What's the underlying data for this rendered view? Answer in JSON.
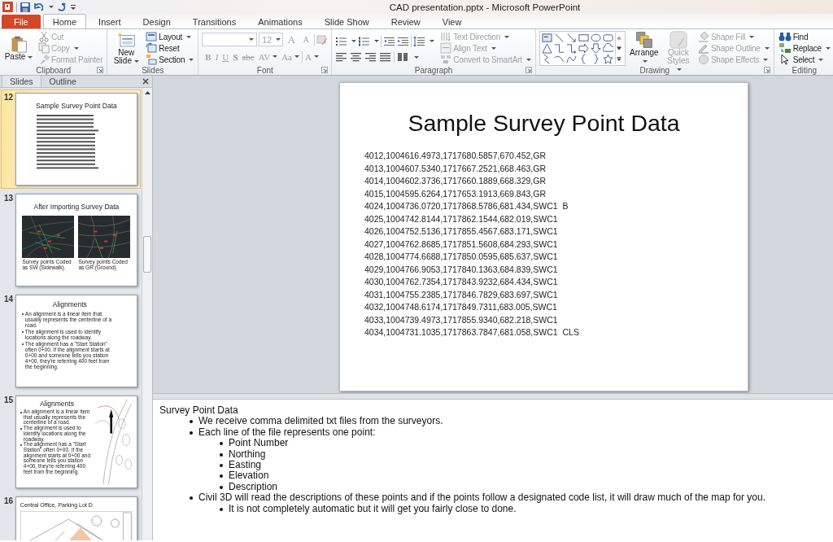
{
  "window": {
    "title": "CAD presentation.pptx  -  Microsoft PowerPoint"
  },
  "ribbon_tabs": [
    {
      "label": "File",
      "kind": "file",
      "selected": false
    },
    {
      "label": "Home",
      "kind": "tab",
      "selected": true
    },
    {
      "label": "Insert",
      "kind": "tab",
      "selected": false
    },
    {
      "label": "Design",
      "kind": "tab",
      "selected": false
    },
    {
      "label": "Transitions",
      "kind": "tab",
      "selected": false
    },
    {
      "label": "Animations",
      "kind": "tab",
      "selected": false
    },
    {
      "label": "Slide Show",
      "kind": "tab",
      "selected": false
    },
    {
      "label": "Review",
      "kind": "tab",
      "selected": false
    },
    {
      "label": "View",
      "kind": "tab",
      "selected": false
    }
  ],
  "ribbon_groups": [
    {
      "label": "Clipboard",
      "kind": "clipboard",
      "launcher": true,
      "large": [
        {
          "label": "Paste",
          "caret": true,
          "disabled": false
        }
      ],
      "small": [
        {
          "label": "Cut",
          "caret": false,
          "disabled": true
        },
        {
          "label": "Copy",
          "caret": true,
          "disabled": true
        },
        {
          "label": "Format Painter",
          "caret": false,
          "disabled": true
        }
      ]
    },
    {
      "label": "Slides",
      "kind": "slides",
      "launcher": false,
      "large": [
        {
          "label": "New Slide",
          "caret": true,
          "disabled": false
        }
      ],
      "small": [
        {
          "label": "Layout",
          "caret": true,
          "disabled": false
        },
        {
          "label": "Reset",
          "caret": false,
          "disabled": false
        },
        {
          "label": "Section",
          "caret": true,
          "disabled": false
        }
      ]
    },
    {
      "label": "Font",
      "kind": "font",
      "launcher": true,
      "disabled": true,
      "size": "12",
      "size_buttons": [
        "A",
        "A"
      ],
      "buttons": [
        "B",
        "I",
        "U",
        "S",
        "abc",
        "AV",
        "Aa",
        "A"
      ]
    },
    {
      "label": "Paragraph",
      "kind": "paragraph",
      "launcher": true,
      "small": [
        {
          "label": "Text Direction",
          "caret": true,
          "disabled": true
        },
        {
          "label": "Align Text",
          "caret": true,
          "disabled": true
        },
        {
          "label": "Convert to SmartArt",
          "caret": true,
          "disabled": true
        }
      ]
    },
    {
      "label": "Drawing",
      "kind": "drawing",
      "launcher": true,
      "large": [
        {
          "label": "Arrange",
          "caret": true,
          "disabled": false
        },
        {
          "label": "Quick Styles",
          "caret": true,
          "disabled": true
        }
      ],
      "small": [
        {
          "label": "Shape Fill",
          "caret": true,
          "disabled": true
        },
        {
          "label": "Shape Outline",
          "caret": true,
          "disabled": true
        },
        {
          "label": "Shape Effects",
          "caret": true,
          "disabled": true
        }
      ]
    },
    {
      "label": "Editing",
      "kind": "editing",
      "launcher": false,
      "small": [
        {
          "label": "Find",
          "caret": false,
          "disabled": false
        },
        {
          "label": "Replace",
          "caret": true,
          "disabled": false
        },
        {
          "label": "Select",
          "caret": true,
          "disabled": false
        }
      ]
    }
  ],
  "slide_panel": {
    "tabs": [
      {
        "label": "Slides",
        "selected": true
      },
      {
        "label": "Outline",
        "selected": false
      }
    ],
    "slides": [
      {
        "number": "12",
        "kind": "data",
        "selected": true,
        "title": "Sample Survey Point Data"
      },
      {
        "number": "13",
        "kind": "pictures",
        "selected": false,
        "title": "After  Importing Survey Data",
        "captions": [
          "Survey points Coded as SW (Sidewalk).",
          "Survey points Coded as GR (Ground)."
        ]
      },
      {
        "number": "14",
        "kind": "bullets",
        "selected": false,
        "title": "Alignments",
        "bullets": [
          "An alignment  is a linear item that usually represents the centerline of a road.",
          "The alignment is used to identify locations along the roadway.",
          "The alignment has a \"Start Station\" often 0+00.  If the alignment starts at 0+00 and someone tells you station 4+00, they're referring  400 feet from the beginning."
        ]
      },
      {
        "number": "15",
        "kind": "bullets_picture",
        "selected": false,
        "title": "Alignments",
        "bullets": [
          "An alignment  is a linear item that usually represents the centerline of a road.",
          "The alignment is used to identify locations along the roadway.",
          "The alignment has a \"Start Station\" often 0+00.  If the alignment starts at 0+00 and someone tells you station 4+00, they're referring  400 feet from the beginning."
        ]
      },
      {
        "number": "16",
        "kind": "plan",
        "selected": false,
        "title": "Central Office, Parking Lot D"
      }
    ]
  },
  "slide": {
    "title": "Sample Survey Point Data",
    "lines": [
      "4012,1004616.4973,1717680.5857,670.452,GR",
      "4013,1004607.5340,1717667.2521,668.463,GR",
      "4014,1004602.3736,1717660.1889,668.329,GR",
      "4015,1004595.6264,1717653.1913,669.843,GR",
      "4024,1004736.0720,1717868.5786,681.434,SWC1  B",
      "4025,1004742.8144,1717862.1544,682.019,SWC1",
      "4026,1004752.5136,1717855.4567,683.171,SWC1",
      "4027,1004762.8685,1717851.5608,684.293,SWC1",
      "4028,1004774.6688,1717850.0595,685.637,SWC1",
      "4029,1004766.9053,1717840.1363,684.839,SWC1",
      "4030,1004762.7354,1717843.9232,684.434,SWC1",
      "4031,1004755.2385,1717846.7829,683.697,SWC1",
      "4032,1004748.6174,1717849.7311,683.005,SWC1",
      "4033,1004739.4973,1717855.9340,682.218,SWC1",
      "4034,1004731.1035,1717863.7847,681.058,SWC1  CLS"
    ]
  },
  "notes": {
    "heading": "Survey Point Data",
    "items": [
      {
        "text": "We receive comma delimited txt files from the surveyors."
      },
      {
        "text": "Each line of the file represents  one point:",
        "children": [
          {
            "text": "Point Number"
          },
          {
            "text": "Northing"
          },
          {
            "text": "Easting"
          },
          {
            "text": "Elevation"
          },
          {
            "text": "Description"
          }
        ]
      },
      {
        "text": "Civil 3D will read the descriptions of these points and if the points follow a designated code list, it will draw much of the map for you.",
        "children": [
          {
            "text": "It is not completely automatic but it will get you fairly close to done."
          }
        ]
      }
    ]
  }
}
